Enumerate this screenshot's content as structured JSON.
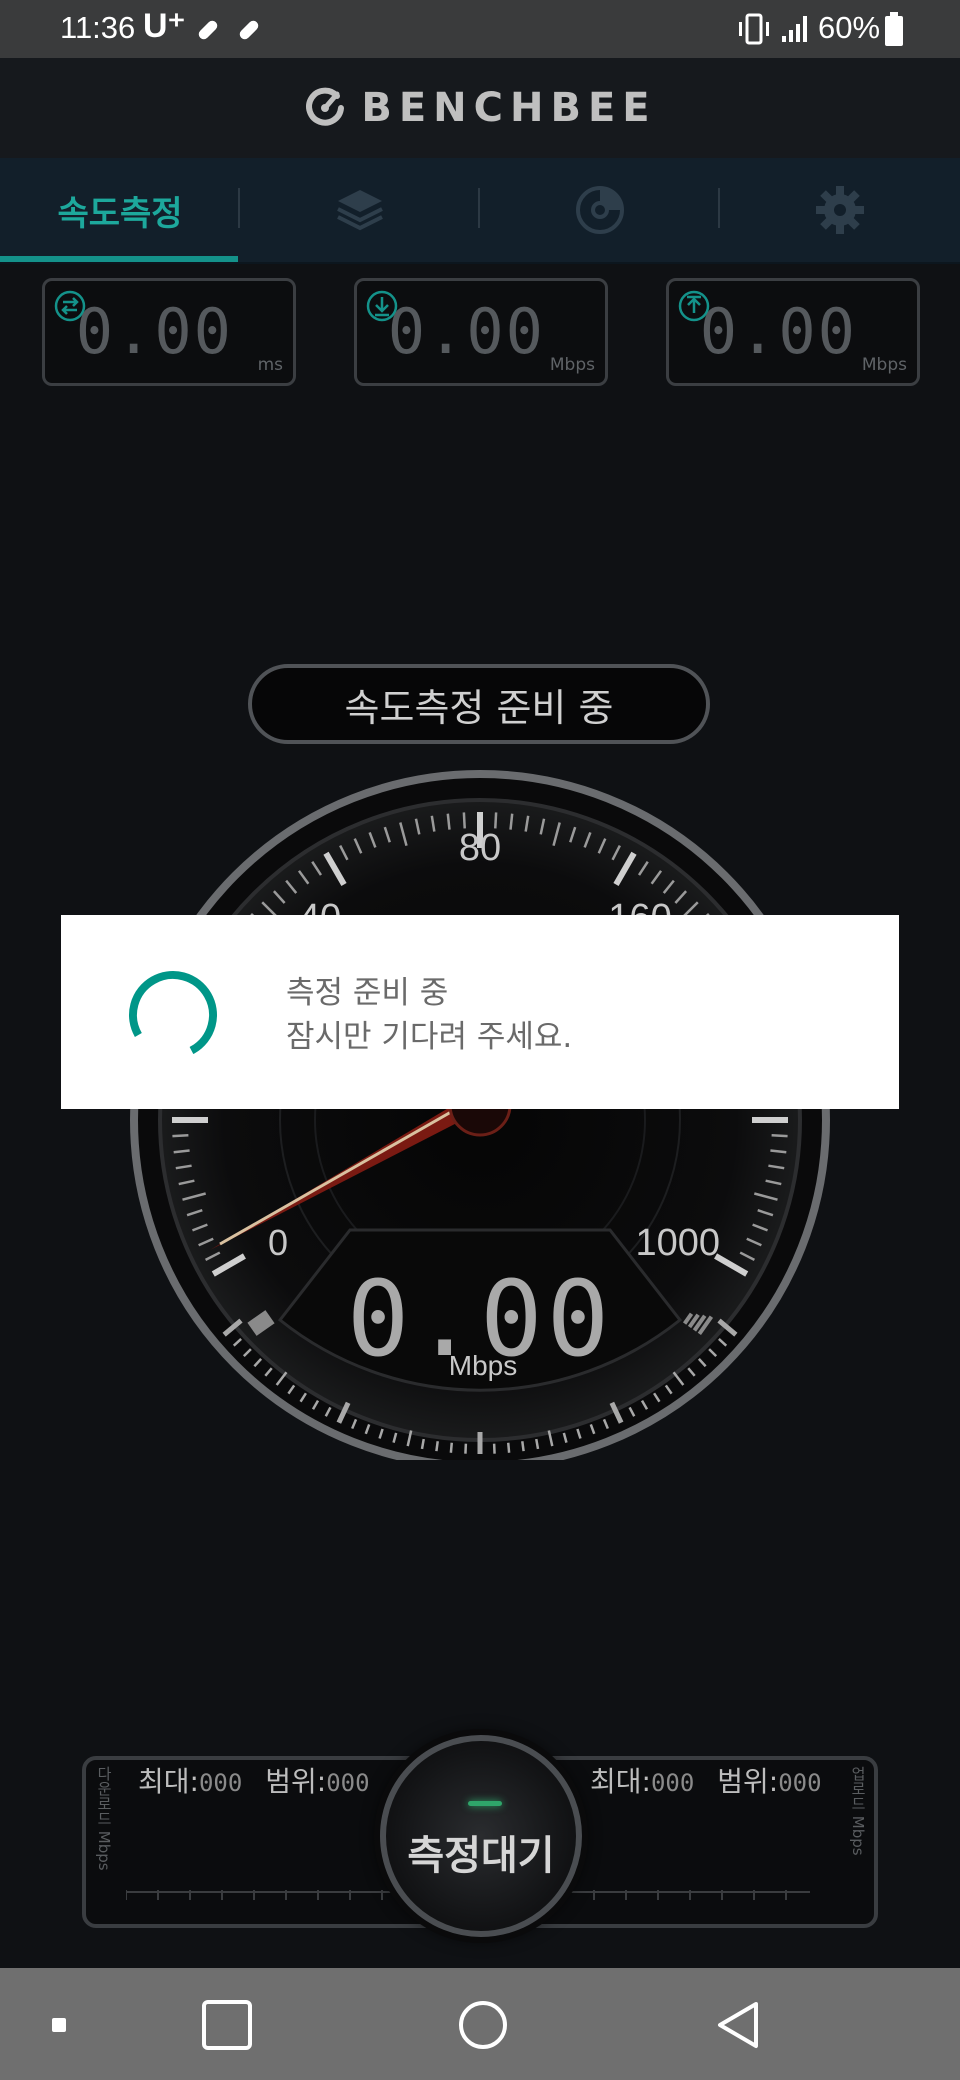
{
  "status_bar": {
    "time": "11:36",
    "carrier": "U⁺",
    "battery_percent": "60%"
  },
  "header": {
    "brand": "BENCHBEE"
  },
  "tabs": [
    {
      "label": "속도측정",
      "icon": "speed-test",
      "active": true
    },
    {
      "label": "",
      "icon": "layers-icon",
      "active": false
    },
    {
      "label": "",
      "icon": "disc-chart-icon",
      "active": false
    },
    {
      "label": "",
      "icon": "gear-icon",
      "active": false
    }
  ],
  "metrics": [
    {
      "icon": "ping-swap-icon",
      "value": "0.00",
      "unit": "ms"
    },
    {
      "icon": "download-icon",
      "value": "0.00",
      "unit": "Mbps"
    },
    {
      "icon": "upload-icon",
      "value": "0.00",
      "unit": "Mbps"
    }
  ],
  "status_pill": "속도측정 준비 중",
  "gauge": {
    "labels": {
      "min": "0",
      "top": "80",
      "left_upper": "40",
      "right_upper": "160",
      "max": "1000"
    },
    "value": "0.00",
    "unit": "Mbps"
  },
  "dialog": {
    "line1": "측정 준비 중",
    "line2": "잠시만 기다려 주세요."
  },
  "graph_panel": {
    "left": {
      "max_label": "최대:",
      "max_value": "000",
      "range_label": "범위:",
      "range_value": "000",
      "side_label": "다운로드 Mbps"
    },
    "right": {
      "max_label": "최대:",
      "max_value": "000",
      "range_label": "범위:",
      "range_value": "000",
      "side_label": "업로드 Mbps"
    },
    "button_label": "측정대기"
  },
  "colors": {
    "accent": "#14928a",
    "background": "#0f1114",
    "needle": "#c0392b"
  }
}
